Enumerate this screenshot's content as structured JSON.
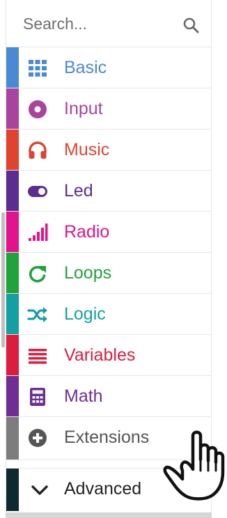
{
  "search": {
    "placeholder": "Search..."
  },
  "categories": [
    {
      "label": "Basic",
      "color": "#4a8ad4",
      "icon": "grid-icon"
    },
    {
      "label": "Input",
      "color": "#a8449d",
      "icon": "target-icon"
    },
    {
      "label": "Music",
      "color": "#e0432e",
      "icon": "headphones-icon"
    },
    {
      "label": "Led",
      "color": "#5c2d91",
      "icon": "toggle-icon"
    },
    {
      "label": "Radio",
      "color": "#e3138b",
      "icon": "signal-bars-icon"
    },
    {
      "label": "Loops",
      "color": "#1fa33a",
      "icon": "loop-arrow-icon"
    },
    {
      "label": "Logic",
      "color": "#159fa3",
      "icon": "shuffle-icon"
    },
    {
      "label": "Variables",
      "color": "#dc1d3e",
      "icon": "list-lines-icon"
    },
    {
      "label": "Math",
      "color": "#6e2e94",
      "icon": "calculator-icon"
    },
    {
      "label": "Extensions",
      "color": "#7d7d7d",
      "icon": "plus-circle-icon"
    }
  ],
  "advanced": {
    "label": "Advanced",
    "color": "#0e2a31",
    "icon": "chevron-down-icon"
  }
}
